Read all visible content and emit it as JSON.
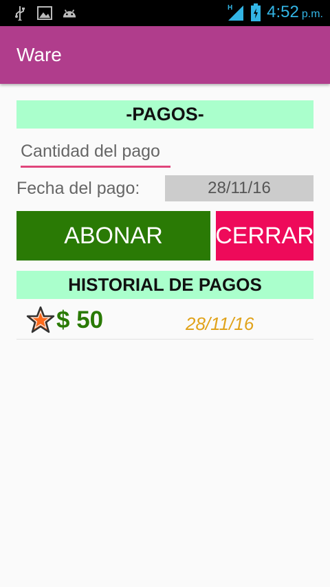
{
  "status_bar": {
    "time": "4:52",
    "ampm": "p.m.",
    "icons": [
      "usb-icon",
      "image-icon",
      "android-icon",
      "signal-icon",
      "battery-icon"
    ]
  },
  "app_bar": {
    "title": "Ware"
  },
  "pagos": {
    "header": "-PAGOS-",
    "amount_placeholder": "Cantidad del pago",
    "amount_value": "",
    "date_label": "Fecha del pago:",
    "date_value": "28/11/16"
  },
  "actions": {
    "abonar_label": "ABONAR",
    "cerrar_label": "CERRAR"
  },
  "historial": {
    "header": "HISTORIAL DE PAGOS",
    "items": [
      {
        "amount": "$ 50",
        "date": "28/11/16",
        "icon": "star-icon"
      }
    ]
  },
  "colors": {
    "app_bar": "#b03d8c",
    "header_bg": "#aaffcc",
    "abonar": "#2a7a05",
    "cerrar": "#ee0a5a",
    "date_text": "#e0a21a",
    "accent_underline": "#e0457b",
    "status_icons": "#33b5e5"
  }
}
